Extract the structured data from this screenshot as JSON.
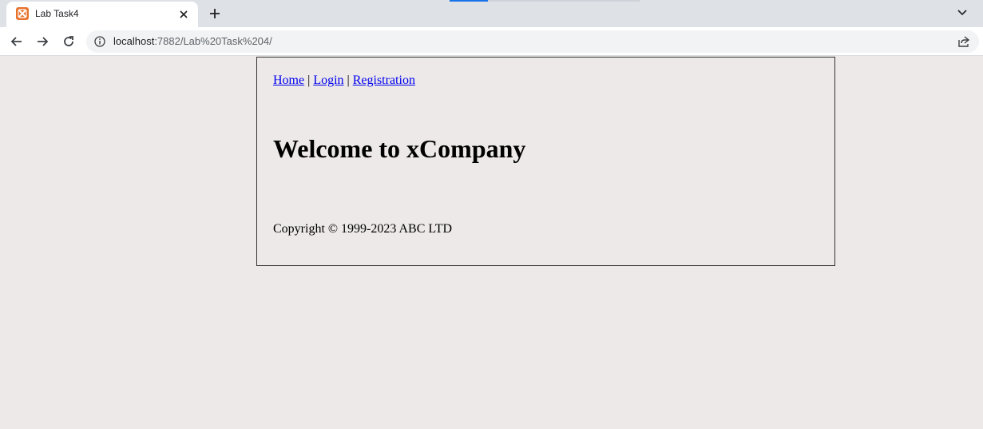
{
  "browser": {
    "tab_title": "Lab Task4",
    "url_host": "localhost",
    "url_path": ":7882/Lab%20Task%204/",
    "favicon": "xampp-icon"
  },
  "page": {
    "nav": {
      "home": "Home",
      "login": "Login",
      "registration": "Registration",
      "separator": "|"
    },
    "heading": "Welcome to xCompany",
    "footer": "Copyright © 1999-2023 ABC LTD"
  },
  "colors": {
    "page_background": "#ede9e8",
    "link": "#0000ee",
    "favicon": "#e8722c"
  }
}
